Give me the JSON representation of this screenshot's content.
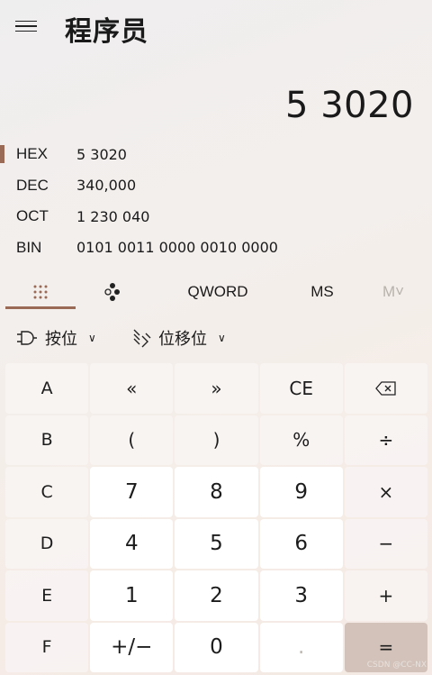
{
  "header": {
    "title": "程序员",
    "menu_icon": "hamburger-menu-icon"
  },
  "display": {
    "value": "5 3020"
  },
  "radix": [
    {
      "label": "HEX",
      "value": "5 3020",
      "active": true
    },
    {
      "label": "DEC",
      "value": "340,000",
      "active": false
    },
    {
      "label": "OCT",
      "value": "1 230 040",
      "active": false
    },
    {
      "label": "BIN",
      "value": "0101 0011 0000 0010 0000",
      "active": false
    }
  ],
  "modes": {
    "keypad_icon": "keypad-grid-icon",
    "bits_icon": "bit-toggle-icon",
    "word_size": "QWORD",
    "ms": "MS",
    "mr": "M˅"
  },
  "toolbar": {
    "bitwise_label": "按位",
    "bitshift_label": "位移位",
    "chevron": "∨"
  },
  "keys": [
    "A",
    "«",
    "»",
    "CE",
    "backspace",
    "B",
    "(",
    ")",
    "%",
    "÷",
    "C",
    "7",
    "8",
    "9",
    "×",
    "D",
    "4",
    "5",
    "6",
    "−",
    "E",
    "1",
    "2",
    "3",
    "+",
    "F",
    "+/−",
    "0",
    ".",
    "="
  ],
  "watermark": "CSDN @CC-NX",
  "colors": {
    "accent": "#9a6a56",
    "equals": "#d3c2b9"
  }
}
